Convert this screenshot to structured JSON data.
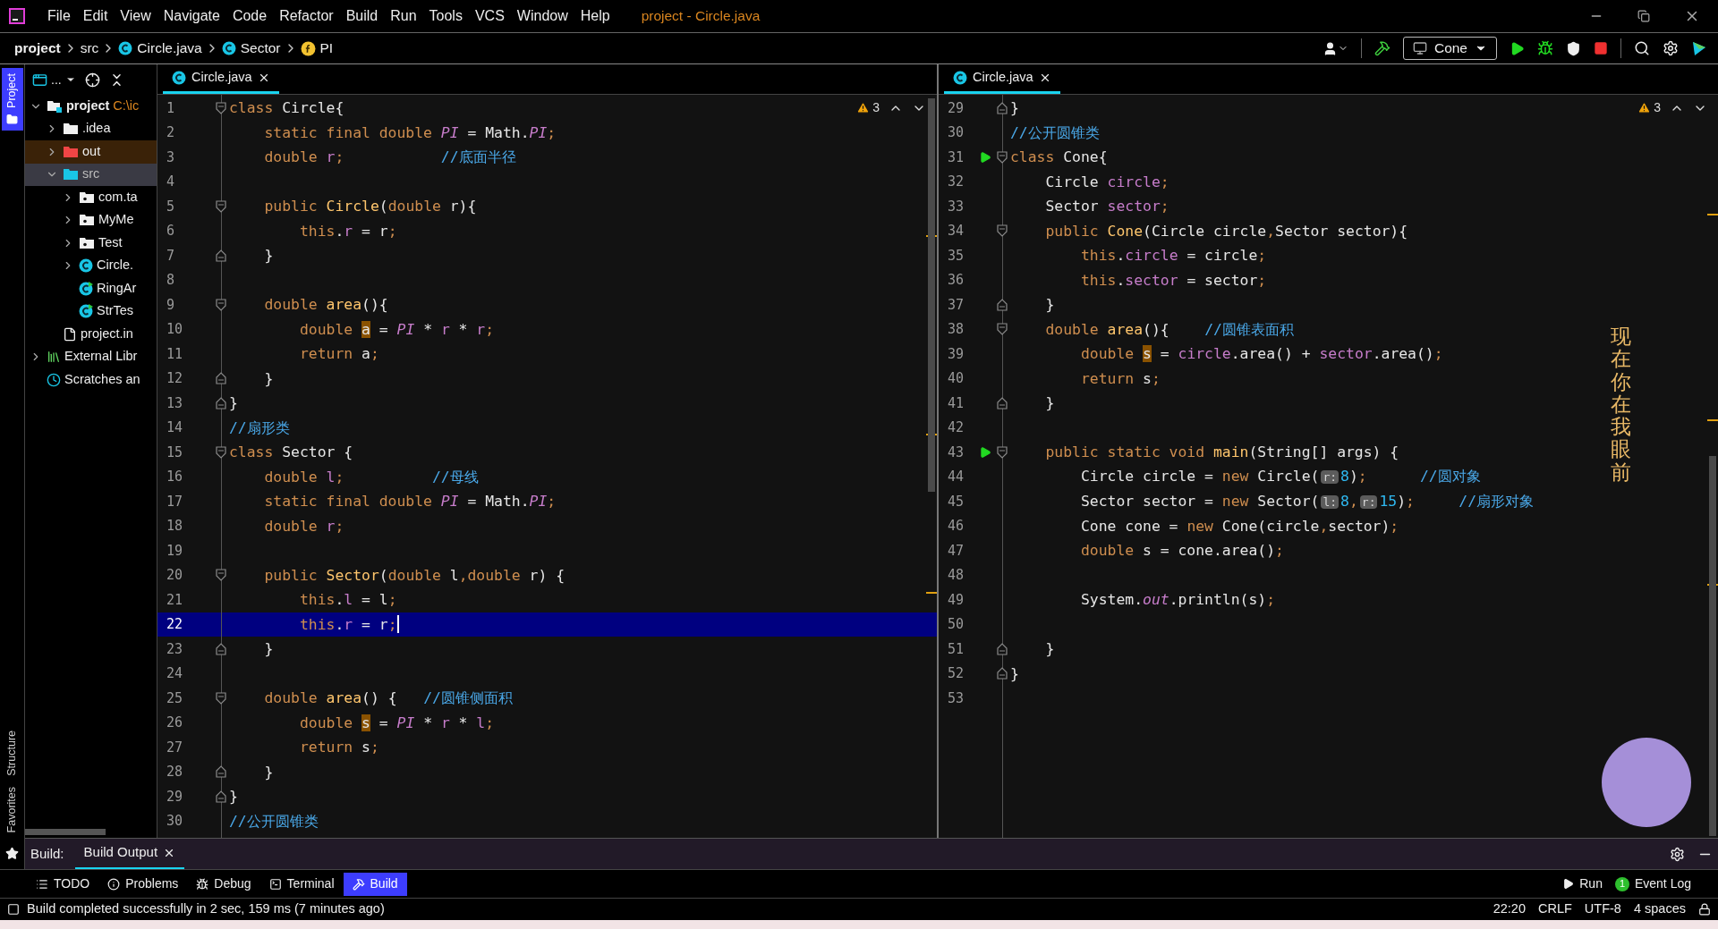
{
  "menu_bar": {
    "items": [
      "File",
      "Edit",
      "View",
      "Navigate",
      "Code",
      "Refactor",
      "Build",
      "Run",
      "Tools",
      "VCS",
      "Window",
      "Help"
    ],
    "title": "project - Circle.java"
  },
  "breadcrumbs": [
    {
      "kind": "module",
      "label": "project"
    },
    {
      "kind": "folder",
      "label": "src"
    },
    {
      "kind": "class",
      "label": "Circle.java"
    },
    {
      "kind": "class",
      "label": "Sector"
    },
    {
      "kind": "field",
      "label": "PI"
    }
  ],
  "run_config": {
    "label": "Cone"
  },
  "side_tabs": [
    {
      "label": "Project",
      "selected": true
    },
    {
      "label": "Structure",
      "selected": false
    },
    {
      "label": "Favorites",
      "selected": false
    }
  ],
  "project_panel": {
    "toolbar_label": "...",
    "tree": [
      {
        "kind": "module",
        "label": "project",
        "path": "C:\\ic",
        "expanded": true,
        "selected": false,
        "children": [
          {
            "kind": "folder",
            "label": ".idea",
            "expanded": false,
            "selected": false
          },
          {
            "kind": "excluded",
            "label": "out",
            "expanded": false,
            "selected": false
          },
          {
            "kind": "source",
            "label": "src",
            "expanded": true,
            "selected": true,
            "children": [
              {
                "kind": "package",
                "label": "com.ta",
                "expanded": false,
                "selected": false
              },
              {
                "kind": "package",
                "label": "MyMe",
                "expanded": false,
                "selected": false
              },
              {
                "kind": "package",
                "label": "Test",
                "expanded": false,
                "selected": false
              },
              {
                "kind": "class",
                "label": "Circle.",
                "expanded": false,
                "selected": false
              },
              {
                "kind": "runnable",
                "label": "RingAr",
                "selected": false
              },
              {
                "kind": "runnable",
                "label": "StrTes",
                "selected": false
              }
            ]
          },
          {
            "kind": "file",
            "label": "project.in",
            "selected": false
          }
        ]
      },
      {
        "kind": "library",
        "label": "External Libr",
        "expanded": false,
        "selected": false
      },
      {
        "kind": "scratches",
        "label": "Scratches an",
        "selected": false
      }
    ]
  },
  "editors": [
    {
      "tab": {
        "label": "Circle.java",
        "selected": true
      },
      "warnings": "3",
      "lines": [
        {
          "number": "1",
          "kind": "fold_start",
          "run": false,
          "selected": false,
          "tokens": [
            {
              "kind": "kw",
              "text": "class"
            },
            {
              "kind": "txt",
              "text": " Circle{"
            }
          ]
        },
        {
          "number": "2",
          "run": false,
          "selected": false,
          "tokens": [
            {
              "kind": "kw",
              "text": "    static final double "
            },
            {
              "kind": "stc",
              "text": "PI"
            },
            {
              "kind": "txt",
              "text": " = Math."
            },
            {
              "kind": "stc",
              "text": "PI"
            },
            {
              "kind": "kw",
              "text": ";"
            }
          ]
        },
        {
          "number": "3",
          "run": false,
          "selected": false,
          "tokens": [
            {
              "kind": "kw",
              "text": "    double "
            },
            {
              "kind": "fld",
              "text": "r"
            },
            {
              "kind": "kw",
              "text": ";           "
            },
            {
              "kind": "cmt",
              "text": "//底面半径"
            }
          ]
        },
        {
          "number": "4",
          "run": false,
          "selected": false
        },
        {
          "number": "5",
          "kind": "fold_start",
          "run": false,
          "selected": false,
          "tokens": [
            {
              "kind": "kw",
              "text": "    public "
            },
            {
              "kind": "fn",
              "text": "Circle"
            },
            {
              "kind": "txt",
              "text": "("
            },
            {
              "kind": "kw",
              "text": "double"
            },
            {
              "kind": "txt",
              "text": " r){"
            }
          ]
        },
        {
          "number": "6",
          "run": false,
          "selected": false,
          "tokens": [
            {
              "kind": "kw",
              "text": "        this"
            },
            {
              "kind": "txt",
              "text": "."
            },
            {
              "kind": "fld",
              "text": "r"
            },
            {
              "kind": "txt",
              "text": " = r"
            },
            {
              "kind": "kw",
              "text": ";"
            }
          ]
        },
        {
          "number": "7",
          "kind": "fold_end",
          "run": false,
          "selected": false,
          "tokens": [
            {
              "kind": "txt",
              "text": "    }"
            }
          ]
        },
        {
          "number": "8",
          "run": false,
          "selected": false
        },
        {
          "number": "9",
          "kind": "fold_start",
          "run": false,
          "selected": false,
          "tokens": [
            {
              "kind": "kw",
              "text": "    double "
            },
            {
              "kind": "fn",
              "text": "area"
            },
            {
              "kind": "txt",
              "text": "(){"
            }
          ]
        },
        {
          "number": "10",
          "run": false,
          "selected": false,
          "tokens": [
            {
              "kind": "kw",
              "text": "        double "
            },
            {
              "kind": "var",
              "text": "a"
            },
            {
              "kind": "txt",
              "text": " = "
            },
            {
              "kind": "stc",
              "text": "PI"
            },
            {
              "kind": "txt",
              "text": " * "
            },
            {
              "kind": "fld",
              "text": "r"
            },
            {
              "kind": "txt",
              "text": " * "
            },
            {
              "kind": "fld",
              "text": "r"
            },
            {
              "kind": "kw",
              "text": ";"
            }
          ]
        },
        {
          "number": "11",
          "run": false,
          "selected": false,
          "tokens": [
            {
              "kind": "kw",
              "text": "        return"
            },
            {
              "kind": "txt",
              "text": " a"
            },
            {
              "kind": "kw",
              "text": ";"
            }
          ]
        },
        {
          "number": "12",
          "kind": "fold_end",
          "run": false,
          "selected": false,
          "tokens": [
            {
              "kind": "txt",
              "text": "    }"
            }
          ]
        },
        {
          "number": "13",
          "kind": "fold_end",
          "run": false,
          "selected": false,
          "tokens": [
            {
              "kind": "txt",
              "text": "}"
            }
          ]
        },
        {
          "number": "14",
          "run": false,
          "selected": false,
          "tokens": [
            {
              "kind": "cmt",
              "text": "//扇形类"
            }
          ]
        },
        {
          "number": "15",
          "kind": "fold_start",
          "run": false,
          "selected": false,
          "tokens": [
            {
              "kind": "kw",
              "text": "class"
            },
            {
              "kind": "txt",
              "text": " Sector {"
            }
          ]
        },
        {
          "number": "16",
          "run": false,
          "selected": false,
          "tokens": [
            {
              "kind": "kw",
              "text": "    double "
            },
            {
              "kind": "fld",
              "text": "l"
            },
            {
              "kind": "kw",
              "text": ";          "
            },
            {
              "kind": "cmt",
              "text": "//母线"
            }
          ]
        },
        {
          "number": "17",
          "run": false,
          "selected": false,
          "tokens": [
            {
              "kind": "kw",
              "text": "    static final double "
            },
            {
              "kind": "stc",
              "text": "PI"
            },
            {
              "kind": "txt",
              "text": " = Math."
            },
            {
              "kind": "stc",
              "text": "PI"
            },
            {
              "kind": "kw",
              "text": ";"
            }
          ]
        },
        {
          "number": "18",
          "run": false,
          "selected": false,
          "tokens": [
            {
              "kind": "kw",
              "text": "    double "
            },
            {
              "kind": "fld",
              "text": "r"
            },
            {
              "kind": "kw",
              "text": ";"
            }
          ]
        },
        {
          "number": "19",
          "run": false,
          "selected": false
        },
        {
          "number": "20",
          "kind": "fold_start",
          "run": false,
          "selected": false,
          "tokens": [
            {
              "kind": "kw",
              "text": "    public "
            },
            {
              "kind": "fn",
              "text": "Sector"
            },
            {
              "kind": "txt",
              "text": "("
            },
            {
              "kind": "kw",
              "text": "double"
            },
            {
              "kind": "txt",
              "text": " l"
            },
            {
              "kind": "kw",
              "text": ",double"
            },
            {
              "kind": "txt",
              "text": " r) {"
            }
          ]
        },
        {
          "number": "21",
          "run": false,
          "selected": false,
          "tokens": [
            {
              "kind": "kw",
              "text": "        this"
            },
            {
              "kind": "txt",
              "text": "."
            },
            {
              "kind": "fld",
              "text": "l"
            },
            {
              "kind": "txt",
              "text": " = l"
            },
            {
              "kind": "kw",
              "text": ";"
            }
          ]
        },
        {
          "number": "22",
          "run": false,
          "selected": true,
          "tokens": [
            {
              "kind": "kw",
              "text": "        this"
            },
            {
              "kind": "txt",
              "text": "."
            },
            {
              "kind": "fld",
              "text": "r"
            },
            {
              "kind": "txt",
              "text": " = r"
            },
            {
              "kind": "kw",
              "text": ";"
            }
          ]
        },
        {
          "number": "23",
          "kind": "fold_end",
          "run": false,
          "selected": false,
          "tokens": [
            {
              "kind": "txt",
              "text": "    }"
            }
          ]
        },
        {
          "number": "24",
          "run": false,
          "selected": false
        },
        {
          "number": "25",
          "kind": "fold_start",
          "run": false,
          "selected": false,
          "tokens": [
            {
              "kind": "kw",
              "text": "    double "
            },
            {
              "kind": "fn",
              "text": "area"
            },
            {
              "kind": "txt",
              "text": "() {   "
            },
            {
              "kind": "cmt",
              "text": "//圆锥侧面积"
            }
          ]
        },
        {
          "number": "26",
          "run": false,
          "selected": false,
          "tokens": [
            {
              "kind": "kw",
              "text": "        double "
            },
            {
              "kind": "var",
              "text": "s"
            },
            {
              "kind": "txt",
              "text": " = "
            },
            {
              "kind": "stc",
              "text": "PI"
            },
            {
              "kind": "txt",
              "text": " * "
            },
            {
              "kind": "fld",
              "text": "r"
            },
            {
              "kind": "txt",
              "text": " * "
            },
            {
              "kind": "fld",
              "text": "l"
            },
            {
              "kind": "kw",
              "text": ";"
            }
          ]
        },
        {
          "number": "27",
          "run": false,
          "selected": false,
          "tokens": [
            {
              "kind": "kw",
              "text": "        return"
            },
            {
              "kind": "txt",
              "text": " s"
            },
            {
              "kind": "kw",
              "text": ";"
            }
          ]
        },
        {
          "number": "28",
          "kind": "fold_end",
          "run": false,
          "selected": false,
          "tokens": [
            {
              "kind": "txt",
              "text": "    }"
            }
          ]
        },
        {
          "number": "29",
          "kind": "fold_end",
          "run": false,
          "selected": false,
          "tokens": [
            {
              "kind": "txt",
              "text": "}"
            }
          ]
        },
        {
          "number": "30",
          "run": false,
          "selected": false,
          "tokens": [
            {
              "kind": "cmt",
              "text": "//公开圆锥类"
            }
          ]
        }
      ]
    },
    {
      "tab": {
        "label": "Circle.java",
        "selected": true
      },
      "warnings": "3",
      "overlay_text": "现在你在我眼前",
      "lines": [
        {
          "number": "29",
          "kind": "fold_end",
          "run": false,
          "selected": false,
          "tokens": [
            {
              "kind": "txt",
              "text": "}"
            }
          ]
        },
        {
          "number": "30",
          "run": false,
          "selected": false,
          "tokens": [
            {
              "kind": "cmt",
              "text": "//公开圆锥类"
            }
          ]
        },
        {
          "number": "31",
          "kind": "fold_start",
          "run": true,
          "selected": false,
          "tokens": [
            {
              "kind": "kw",
              "text": "class"
            },
            {
              "kind": "txt",
              "text": " Cone{"
            }
          ]
        },
        {
          "number": "32",
          "run": false,
          "selected": false,
          "tokens": [
            {
              "kind": "txt",
              "text": "    Circle "
            },
            {
              "kind": "fld",
              "text": "circle"
            },
            {
              "kind": "kw",
              "text": ";"
            }
          ]
        },
        {
          "number": "33",
          "run": false,
          "selected": false,
          "tokens": [
            {
              "kind": "txt",
              "text": "    Sector "
            },
            {
              "kind": "fld",
              "text": "sector"
            },
            {
              "kind": "kw",
              "text": ";"
            }
          ]
        },
        {
          "number": "34",
          "kind": "fold_start",
          "run": false,
          "selected": false,
          "tokens": [
            {
              "kind": "kw",
              "text": "    public "
            },
            {
              "kind": "fn",
              "text": "Cone"
            },
            {
              "kind": "txt",
              "text": "(Circle circle"
            },
            {
              "kind": "kw",
              "text": ","
            },
            {
              "kind": "txt",
              "text": "Sector sector){"
            }
          ]
        },
        {
          "number": "35",
          "run": false,
          "selected": false,
          "tokens": [
            {
              "kind": "kw",
              "text": "        this"
            },
            {
              "kind": "txt",
              "text": "."
            },
            {
              "kind": "fld",
              "text": "circle"
            },
            {
              "kind": "txt",
              "text": " = circle"
            },
            {
              "kind": "kw",
              "text": ";"
            }
          ]
        },
        {
          "number": "36",
          "run": false,
          "selected": false,
          "tokens": [
            {
              "kind": "kw",
              "text": "        this"
            },
            {
              "kind": "txt",
              "text": "."
            },
            {
              "kind": "fld",
              "text": "sector"
            },
            {
              "kind": "txt",
              "text": " = sector"
            },
            {
              "kind": "kw",
              "text": ";"
            }
          ]
        },
        {
          "number": "37",
          "kind": "fold_end",
          "run": false,
          "selected": false,
          "tokens": [
            {
              "kind": "txt",
              "text": "    }"
            }
          ]
        },
        {
          "number": "38",
          "kind": "fold_start",
          "run": false,
          "selected": false,
          "tokens": [
            {
              "kind": "kw",
              "text": "    double "
            },
            {
              "kind": "fn",
              "text": "area"
            },
            {
              "kind": "txt",
              "text": "(){    "
            },
            {
              "kind": "cmt",
              "text": "//圆锥表面积"
            }
          ]
        },
        {
          "number": "39",
          "run": false,
          "selected": false,
          "tokens": [
            {
              "kind": "kw",
              "text": "        double "
            },
            {
              "kind": "var",
              "text": "s"
            },
            {
              "kind": "txt",
              "text": " = "
            },
            {
              "kind": "fld",
              "text": "circle"
            },
            {
              "kind": "txt",
              "text": ".area() + "
            },
            {
              "kind": "fld",
              "text": "sector"
            },
            {
              "kind": "txt",
              "text": ".area()"
            },
            {
              "kind": "kw",
              "text": ";"
            }
          ]
        },
        {
          "number": "40",
          "run": false,
          "selected": false,
          "tokens": [
            {
              "kind": "kw",
              "text": "        return"
            },
            {
              "kind": "txt",
              "text": " s"
            },
            {
              "kind": "kw",
              "text": ";"
            }
          ]
        },
        {
          "number": "41",
          "kind": "fold_end",
          "run": false,
          "selected": false,
          "tokens": [
            {
              "kind": "txt",
              "text": "    }"
            }
          ]
        },
        {
          "number": "42",
          "run": false,
          "selected": false
        },
        {
          "number": "43",
          "kind": "fold_start",
          "run": true,
          "selected": false,
          "tokens": [
            {
              "kind": "kw",
              "text": "    public static void "
            },
            {
              "kind": "fn",
              "text": "main"
            },
            {
              "kind": "txt",
              "text": "(String[] args) {"
            }
          ]
        },
        {
          "number": "44",
          "run": false,
          "selected": false,
          "tokens": [
            {
              "kind": "txt",
              "text": "        Circle circle = "
            },
            {
              "kind": "kw",
              "text": "new"
            },
            {
              "kind": "txt",
              "text": " Circle("
            },
            {
              "kind": "hint",
              "text": "r:"
            },
            {
              "kind": "num",
              "text": "8"
            },
            {
              "kind": "txt",
              "text": ")"
            },
            {
              "kind": "kw",
              "text": ";      "
            },
            {
              "kind": "cmt",
              "text": "//圆对象"
            }
          ]
        },
        {
          "number": "45",
          "run": false,
          "selected": false,
          "tokens": [
            {
              "kind": "txt",
              "text": "        Sector sector = "
            },
            {
              "kind": "kw",
              "text": "new"
            },
            {
              "kind": "txt",
              "text": " Sector("
            },
            {
              "kind": "hint",
              "text": "l:"
            },
            {
              "kind": "num",
              "text": "8"
            },
            {
              "kind": "kw",
              "text": ","
            },
            {
              "kind": "hint",
              "text": "r:"
            },
            {
              "kind": "num",
              "text": "15"
            },
            {
              "kind": "txt",
              "text": ")"
            },
            {
              "kind": "kw",
              "text": ";     "
            },
            {
              "kind": "cmt",
              "text": "//扇形对象"
            }
          ]
        },
        {
          "number": "46",
          "run": false,
          "selected": false,
          "tokens": [
            {
              "kind": "txt",
              "text": "        Cone cone = "
            },
            {
              "kind": "kw",
              "text": "new"
            },
            {
              "kind": "txt",
              "text": " Cone(circle"
            },
            {
              "kind": "kw",
              "text": ","
            },
            {
              "kind": "txt",
              "text": "sector)"
            },
            {
              "kind": "kw",
              "text": ";"
            }
          ]
        },
        {
          "number": "47",
          "run": false,
          "selected": false,
          "tokens": [
            {
              "kind": "kw",
              "text": "        double"
            },
            {
              "kind": "txt",
              "text": " s = cone.area()"
            },
            {
              "kind": "kw",
              "text": ";"
            }
          ]
        },
        {
          "number": "48",
          "run": false,
          "selected": false
        },
        {
          "number": "49",
          "run": false,
          "selected": false,
          "tokens": [
            {
              "kind": "txt",
              "text": "        System."
            },
            {
              "kind": "stc",
              "text": "out"
            },
            {
              "kind": "txt",
              "text": ".println(s)"
            },
            {
              "kind": "kw",
              "text": ";"
            }
          ]
        },
        {
          "number": "50",
          "run": false,
          "selected": false
        },
        {
          "number": "51",
          "kind": "fold_end",
          "run": false,
          "selected": false,
          "tokens": [
            {
              "kind": "txt",
              "text": "    }"
            }
          ]
        },
        {
          "number": "52",
          "kind": "fold_end",
          "run": false,
          "selected": false,
          "tokens": [
            {
              "kind": "txt",
              "text": "}"
            }
          ]
        },
        {
          "number": "53",
          "run": false,
          "selected": false
        }
      ]
    }
  ],
  "build_panel": {
    "label": "Build:",
    "tabs": [
      {
        "label": "Build Output",
        "selected": true
      }
    ]
  },
  "tool_tabs": [
    {
      "label": "TODO",
      "selected": false
    },
    {
      "label": "Problems",
      "selected": false
    },
    {
      "label": "Debug",
      "selected": false
    },
    {
      "label": "Terminal",
      "selected": false
    },
    {
      "label": "Build",
      "selected": true
    }
  ],
  "right_tool_tabs": [
    {
      "label": "Run"
    },
    {
      "label": "Event Log",
      "badge": "1"
    }
  ],
  "status_bar": {
    "message": "Build completed successfully in 2 sec, 159 ms (7 minutes ago)",
    "items": [
      "22:20",
      "CRLF",
      "UTF-8",
      "4 spaces"
    ]
  }
}
